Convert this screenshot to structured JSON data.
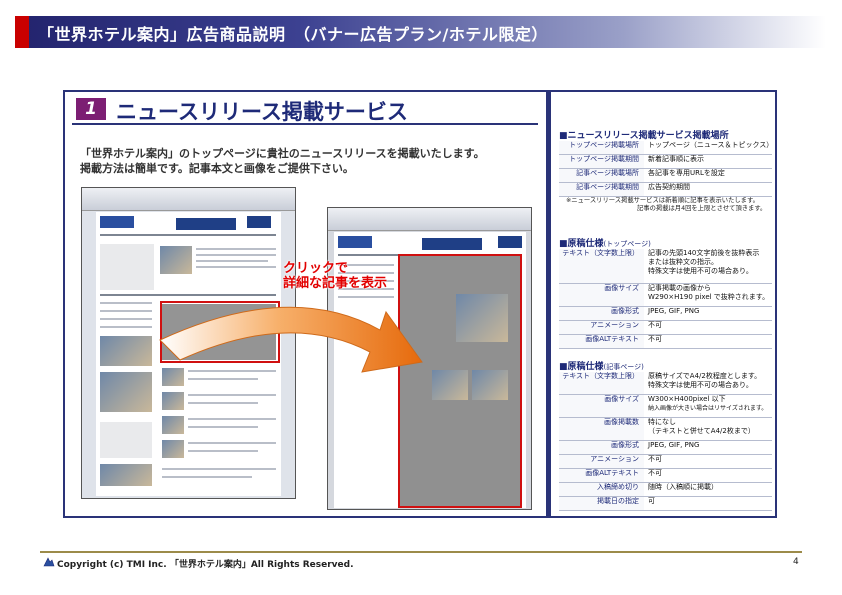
{
  "header": {
    "title": "「世界ホテル案内」広告商品説明　（バナー広告プラン/ホテル限定）"
  },
  "service": {
    "number": "1",
    "title": "ニュースリリース掲載サービス",
    "intro_line1": "「世界ホテル案内」のトップページに貴社のニュースリリースを掲載いたします。",
    "intro_line2": "掲載方法は簡単です。記事本文と画像をご提供下さい。",
    "click_line1": "クリックで",
    "click_line2": "詳細な記事を表示"
  },
  "placement": {
    "title": "■ニュースリリース掲載サービス掲載場所",
    "rows": [
      {
        "key": "トップページ掲載場所",
        "value": "トップページ（ニュース＆トピックス）"
      },
      {
        "key": "トップページ掲載期間",
        "value": "新着記事順に表示"
      },
      {
        "key": "記事ページ掲載場所",
        "value": "各記事を専用URLを設定"
      },
      {
        "key": "記事ページ掲載期間",
        "value": "広告契約期間"
      }
    ],
    "note_line1": "※ニュースリリース掲載サービスは新着順に記事を表示いたします。",
    "note_line2": "記事の掲載は月4回を上限とさせて頂きます。"
  },
  "top_spec": {
    "title": "■原稿仕様",
    "title_sub": "(トップページ)",
    "rows": [
      {
        "key": "テキスト（文字数上限）",
        "value1": "記事の先頭140文字前後を抜粋表示",
        "value2": "または抜粋文の指示。",
        "value3": "特殊文字は使用不可の場合あり。"
      },
      {
        "key": "画像サイズ",
        "value1": "記事掲載の画像から",
        "value2": "W290×H190 pixel で抜粋されます。"
      },
      {
        "key": "画像形式",
        "value1": "JPEG, GIF, PNG"
      },
      {
        "key": "アニメーション",
        "value1": "不可"
      },
      {
        "key": "画像ALTテキスト",
        "value1": "不可"
      }
    ]
  },
  "article_spec": {
    "title": "■原稿仕様",
    "title_sub": "(記事ページ)",
    "rows": [
      {
        "key": "テキスト（文字数上限）",
        "value1": "原稿サイズでA4/2枚程度とします。",
        "value2": "特殊文字は使用不可の場合あり。"
      },
      {
        "key": "画像サイズ",
        "value1": "W300×H400pixel 以下",
        "value2": "納入画像が大きい場合はリサイズされます。"
      },
      {
        "key": "画像掲載数",
        "value1": "特になし",
        "value2": "（テキストと併せてA4/2枚まで）"
      },
      {
        "key": "画像形式",
        "value1": "JPEG, GIF, PNG"
      },
      {
        "key": "アニメーション",
        "value1": "不可"
      },
      {
        "key": "画像ALTテキスト",
        "value1": "不可"
      },
      {
        "key": "入稿締め切り",
        "value1": "随時（入稿順に掲載）"
      },
      {
        "key": "掲載日の指定",
        "value1": "可"
      }
    ]
  },
  "footer": {
    "copyright": "Copyright (c) TMI Inc. 「世界ホテル案内」All Rights Reserved.",
    "page_number": "4"
  },
  "colors": {
    "brand_navy": "#1e2a78",
    "accent_red": "#c90000",
    "badge_purple": "#7c1e73"
  }
}
